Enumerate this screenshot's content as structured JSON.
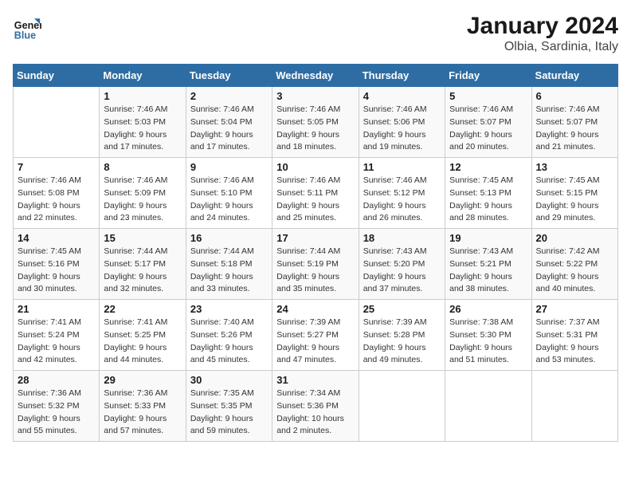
{
  "header": {
    "logo_text_general": "General",
    "logo_text_blue": "Blue",
    "month_year": "January 2024",
    "location": "Olbia, Sardinia, Italy"
  },
  "weekdays": [
    "Sunday",
    "Monday",
    "Tuesday",
    "Wednesday",
    "Thursday",
    "Friday",
    "Saturday"
  ],
  "weeks": [
    [
      {
        "day": "",
        "info": ""
      },
      {
        "day": "1",
        "info": "Sunrise: 7:46 AM\nSunset: 5:03 PM\nDaylight: 9 hours\nand 17 minutes."
      },
      {
        "day": "2",
        "info": "Sunrise: 7:46 AM\nSunset: 5:04 PM\nDaylight: 9 hours\nand 17 minutes."
      },
      {
        "day": "3",
        "info": "Sunrise: 7:46 AM\nSunset: 5:05 PM\nDaylight: 9 hours\nand 18 minutes."
      },
      {
        "day": "4",
        "info": "Sunrise: 7:46 AM\nSunset: 5:06 PM\nDaylight: 9 hours\nand 19 minutes."
      },
      {
        "day": "5",
        "info": "Sunrise: 7:46 AM\nSunset: 5:07 PM\nDaylight: 9 hours\nand 20 minutes."
      },
      {
        "day": "6",
        "info": "Sunrise: 7:46 AM\nSunset: 5:07 PM\nDaylight: 9 hours\nand 21 minutes."
      }
    ],
    [
      {
        "day": "7",
        "info": "Sunrise: 7:46 AM\nSunset: 5:08 PM\nDaylight: 9 hours\nand 22 minutes."
      },
      {
        "day": "8",
        "info": "Sunrise: 7:46 AM\nSunset: 5:09 PM\nDaylight: 9 hours\nand 23 minutes."
      },
      {
        "day": "9",
        "info": "Sunrise: 7:46 AM\nSunset: 5:10 PM\nDaylight: 9 hours\nand 24 minutes."
      },
      {
        "day": "10",
        "info": "Sunrise: 7:46 AM\nSunset: 5:11 PM\nDaylight: 9 hours\nand 25 minutes."
      },
      {
        "day": "11",
        "info": "Sunrise: 7:46 AM\nSunset: 5:12 PM\nDaylight: 9 hours\nand 26 minutes."
      },
      {
        "day": "12",
        "info": "Sunrise: 7:45 AM\nSunset: 5:13 PM\nDaylight: 9 hours\nand 28 minutes."
      },
      {
        "day": "13",
        "info": "Sunrise: 7:45 AM\nSunset: 5:15 PM\nDaylight: 9 hours\nand 29 minutes."
      }
    ],
    [
      {
        "day": "14",
        "info": "Sunrise: 7:45 AM\nSunset: 5:16 PM\nDaylight: 9 hours\nand 30 minutes."
      },
      {
        "day": "15",
        "info": "Sunrise: 7:44 AM\nSunset: 5:17 PM\nDaylight: 9 hours\nand 32 minutes."
      },
      {
        "day": "16",
        "info": "Sunrise: 7:44 AM\nSunset: 5:18 PM\nDaylight: 9 hours\nand 33 minutes."
      },
      {
        "day": "17",
        "info": "Sunrise: 7:44 AM\nSunset: 5:19 PM\nDaylight: 9 hours\nand 35 minutes."
      },
      {
        "day": "18",
        "info": "Sunrise: 7:43 AM\nSunset: 5:20 PM\nDaylight: 9 hours\nand 37 minutes."
      },
      {
        "day": "19",
        "info": "Sunrise: 7:43 AM\nSunset: 5:21 PM\nDaylight: 9 hours\nand 38 minutes."
      },
      {
        "day": "20",
        "info": "Sunrise: 7:42 AM\nSunset: 5:22 PM\nDaylight: 9 hours\nand 40 minutes."
      }
    ],
    [
      {
        "day": "21",
        "info": "Sunrise: 7:41 AM\nSunset: 5:24 PM\nDaylight: 9 hours\nand 42 minutes."
      },
      {
        "day": "22",
        "info": "Sunrise: 7:41 AM\nSunset: 5:25 PM\nDaylight: 9 hours\nand 44 minutes."
      },
      {
        "day": "23",
        "info": "Sunrise: 7:40 AM\nSunset: 5:26 PM\nDaylight: 9 hours\nand 45 minutes."
      },
      {
        "day": "24",
        "info": "Sunrise: 7:39 AM\nSunset: 5:27 PM\nDaylight: 9 hours\nand 47 minutes."
      },
      {
        "day": "25",
        "info": "Sunrise: 7:39 AM\nSunset: 5:28 PM\nDaylight: 9 hours\nand 49 minutes."
      },
      {
        "day": "26",
        "info": "Sunrise: 7:38 AM\nSunset: 5:30 PM\nDaylight: 9 hours\nand 51 minutes."
      },
      {
        "day": "27",
        "info": "Sunrise: 7:37 AM\nSunset: 5:31 PM\nDaylight: 9 hours\nand 53 minutes."
      }
    ],
    [
      {
        "day": "28",
        "info": "Sunrise: 7:36 AM\nSunset: 5:32 PM\nDaylight: 9 hours\nand 55 minutes."
      },
      {
        "day": "29",
        "info": "Sunrise: 7:36 AM\nSunset: 5:33 PM\nDaylight: 9 hours\nand 57 minutes."
      },
      {
        "day": "30",
        "info": "Sunrise: 7:35 AM\nSunset: 5:35 PM\nDaylight: 9 hours\nand 59 minutes."
      },
      {
        "day": "31",
        "info": "Sunrise: 7:34 AM\nSunset: 5:36 PM\nDaylight: 10 hours\nand 2 minutes."
      },
      {
        "day": "",
        "info": ""
      },
      {
        "day": "",
        "info": ""
      },
      {
        "day": "",
        "info": ""
      }
    ]
  ]
}
